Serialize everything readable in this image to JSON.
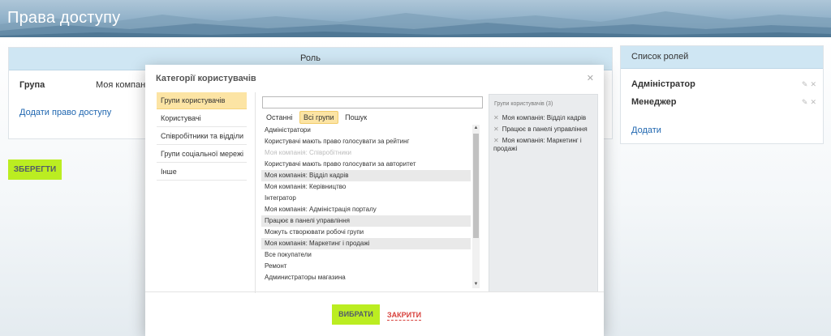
{
  "page": {
    "title": "Права доступу"
  },
  "role_panel": {
    "heading": "Роль",
    "group_label": "Група",
    "group_value": "Моя компанія:",
    "add_access_label": "Додати право доступу"
  },
  "save_label": "ЗБЕРЕГТИ",
  "roles_panel": {
    "heading": "Список ролей",
    "roles": [
      "Адміністратор",
      "Менеджер"
    ],
    "add_label": "Додати"
  },
  "dialog": {
    "title": "Категорії користувачів",
    "categories": [
      "Групи користувачів",
      "Користувачі",
      "Співробітники та відділи",
      "Групи соціальної мережі",
      "Інше"
    ],
    "search_value": "",
    "tabs": [
      "Останні",
      "Всі групи",
      "Пошук"
    ],
    "groups": [
      "Адміністратори",
      "Користувачі мають право голосувати за рейтинг",
      "Моя компанія: Співробітники",
      "Користувачі мають право голосувати за авторитет",
      "Моя компанія: Відділ кадрів",
      "Моя компанія: Керівництво",
      "Інтегратор",
      "Моя компанія: Адміністрація порталу",
      "Працює в панелі управління",
      "Можуть створювати робочі групи",
      "Моя компанія: Маркетинг і продажі",
      "Все покупатели",
      "Ремонт",
      "Администраторы магазина"
    ],
    "selected_heading": "Групи користувачів (3)",
    "selected_items": [
      "Моя компанія: Відділ кадрів",
      "Працює в панелі управління",
      "Моя компанія: Маркетинг і продажі"
    ],
    "choose_label": "ВИБРАТИ",
    "close_label": "ЗАКРИТИ"
  },
  "colors": {
    "accent_green": "#bbed21",
    "link_blue": "#2067b0",
    "tab_highlight": "#fce4a4",
    "close_red": "#d8413c"
  }
}
